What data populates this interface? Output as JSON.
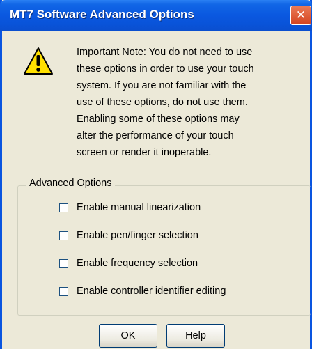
{
  "window": {
    "title": "MT7 Software Advanced Options",
    "close_glyph": "✕"
  },
  "note": {
    "icon": "warning-icon",
    "text": "Important Note: You do not need to use\nthese options in order to use your touch\nsystem. If you are not familiar with the\nuse of these options, do not use them.\nEnabling some of these options may\nalter the performance of your touch\nscreen or render it inoperable."
  },
  "advanced": {
    "group_label": "Advanced Options",
    "options": [
      {
        "label": "Enable manual linearization",
        "checked": false
      },
      {
        "label": "Enable pen/finger selection",
        "checked": false
      },
      {
        "label": "Enable frequency selection",
        "checked": false
      },
      {
        "label": "Enable controller identifier editing",
        "checked": false
      }
    ]
  },
  "buttons": {
    "ok": "OK",
    "help": "Help"
  },
  "colors": {
    "titlebar": "#0a58e0",
    "face": "#ece9d8",
    "close": "#d5431f",
    "warning": "#ffe000"
  }
}
